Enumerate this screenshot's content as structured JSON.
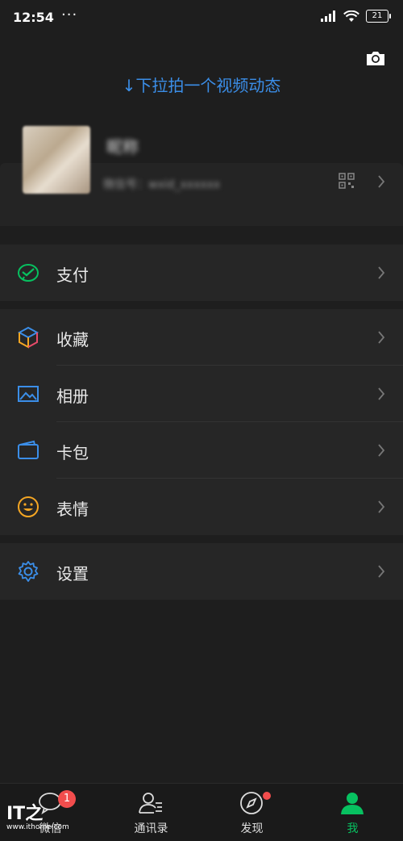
{
  "status": {
    "time": "12:54",
    "dots": "···",
    "battery": "21"
  },
  "header": {
    "pull_hint": "↓下拉拍一个视频动态"
  },
  "profile": {
    "nickname": "昵称",
    "wechat_id": "微信号：wxid_xxxxxx"
  },
  "menu": {
    "pay": "支付",
    "favorites": "收藏",
    "album": "相册",
    "cards": "卡包",
    "stickers": "表情",
    "settings": "设置"
  },
  "tabbar": {
    "chats": "微信",
    "chats_badge": "1",
    "contacts": "通讯录",
    "discover": "发现",
    "me": "我"
  },
  "watermark": {
    "logo": "IT之",
    "site": "www.ithome.com"
  },
  "colors": {
    "accent": "#3b8ee8",
    "green": "#07c160",
    "badge": "#f24d4d"
  }
}
